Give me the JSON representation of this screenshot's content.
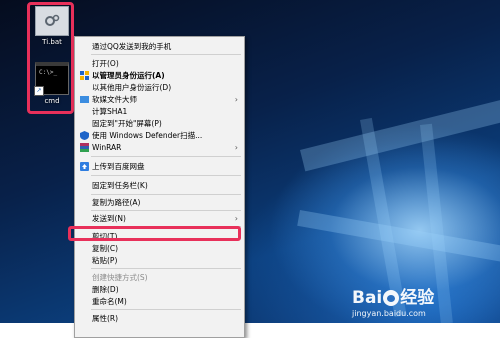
{
  "desktop": {
    "icons": [
      {
        "label": "Ti.bat",
        "icon": "gear-file-icon"
      },
      {
        "label": "cmd",
        "icon": "console-icon",
        "prompt": "C:\\>_"
      }
    ]
  },
  "context_menu": {
    "items": [
      {
        "label": "通过QQ发送到我的手机"
      },
      {
        "label": "打开(O)"
      },
      {
        "label": "以管理员身份运行(A)"
      },
      {
        "label": "以其他用户身份运行(D)"
      },
      {
        "label": "软媒文件大师"
      },
      {
        "label": "计算SHA1"
      },
      {
        "label": "固定到\"开始\"屏幕(P)"
      },
      {
        "label": "使用 Windows Defender扫描..."
      },
      {
        "label": "WinRAR"
      },
      {
        "label": "上传到百度网盘"
      },
      {
        "label": "固定到任务栏(K)"
      },
      {
        "label": "复制为路径(A)"
      },
      {
        "label": "发送到(N)"
      },
      {
        "label": "剪切(T)"
      },
      {
        "label": "复制(C)"
      },
      {
        "label": "粘贴(P)"
      },
      {
        "label": "创建快捷方式(S)"
      },
      {
        "label": "删除(D)"
      },
      {
        "label": "重命名(M)"
      },
      {
        "label": "属性(R)"
      }
    ]
  },
  "highlight_color": "#e8305a",
  "watermark": {
    "main_left": "Bai",
    "main_right": "经验",
    "sub": "jingyan.baidu.com"
  }
}
